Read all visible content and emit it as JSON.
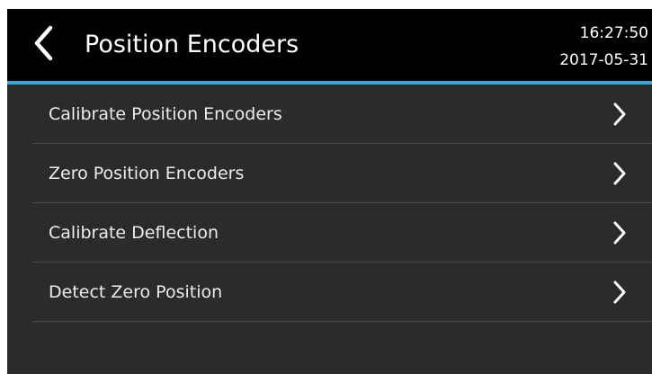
{
  "header": {
    "title": "Position Encoders",
    "time": "16:27:50",
    "date": "2017-05-31",
    "back_icon": "chevron-left-icon"
  },
  "menu": {
    "items": [
      {
        "label": "Calibrate Position Encoders",
        "icon": "chevron-right-icon"
      },
      {
        "label": "Zero Position Encoders",
        "icon": "chevron-right-icon"
      },
      {
        "label": "Calibrate Deflection",
        "icon": "chevron-right-icon"
      },
      {
        "label": "Detect Zero Position",
        "icon": "chevron-right-icon"
      }
    ]
  },
  "colors": {
    "header_background": "#000000",
    "accent": "#38a6d6",
    "body_background": "#2b2b2b",
    "divider": "#4b4b4b",
    "text": "#ffffff"
  }
}
